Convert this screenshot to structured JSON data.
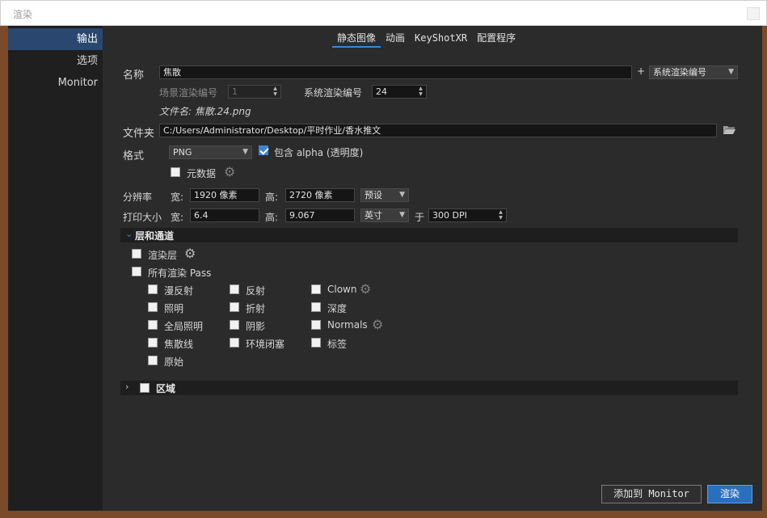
{
  "window": {
    "title": "渲染"
  },
  "sidebar": {
    "items": [
      {
        "label": "输出"
      },
      {
        "label": "选项"
      },
      {
        "label": "Monitor"
      }
    ]
  },
  "tabs": [
    {
      "label": "静态图像"
    },
    {
      "label": "动画"
    },
    {
      "label": "KeyShotXR"
    },
    {
      "label": "配置程序"
    }
  ],
  "form": {
    "name_label": "名称",
    "name_value": "焦散",
    "plus": "+",
    "name_suffix_dropdown": "系统渲染编号",
    "scene_num_label": "场景渲染编号",
    "scene_num_value": "1",
    "system_num_label": "系统渲染编号",
    "system_num_value": "24",
    "filename_text": "文件名: 焦散.24.png",
    "folder_label": "文件夹",
    "folder_value": "C:/Users/Administrator/Desktop/平时作业/香水推文",
    "format_label": "格式",
    "format_value": "PNG",
    "alpha_label": "包含 alpha (透明度)",
    "alpha_checked": true,
    "metadata_label": "元数据",
    "resolution_label": "分辨率",
    "width_label": "宽:",
    "width_value": "1920 像素",
    "height_label": "高:",
    "height_value": "2720 像素",
    "preset_label": "预设",
    "print_size_label": "打印大小",
    "print_width_label": "宽:",
    "print_width_value": "6.4",
    "print_height_label": "高:",
    "print_height_value": "9.067",
    "unit_value": "英寸",
    "at_label": "于",
    "dpi_value": "300 DPI"
  },
  "layers": {
    "title": "层和通道",
    "render_layers": "渲染层",
    "all_passes": "所有渲染 Pass",
    "col1": [
      "漫反射",
      "照明",
      "全局照明",
      "焦散线",
      "原始"
    ],
    "col2": [
      "反射",
      "折射",
      "阴影",
      "环境闭塞"
    ],
    "col3": [
      "Clown",
      "深度",
      "Normals",
      "标签"
    ]
  },
  "region": {
    "title": "区域"
  },
  "buttons": {
    "add_monitor": "添加到 Monitor",
    "render": "渲染"
  },
  "colors": {
    "accent": "#3b86d4",
    "panel": "#2b2b2b",
    "sidebar": "#1f1f1f",
    "selected": "#29476f"
  }
}
